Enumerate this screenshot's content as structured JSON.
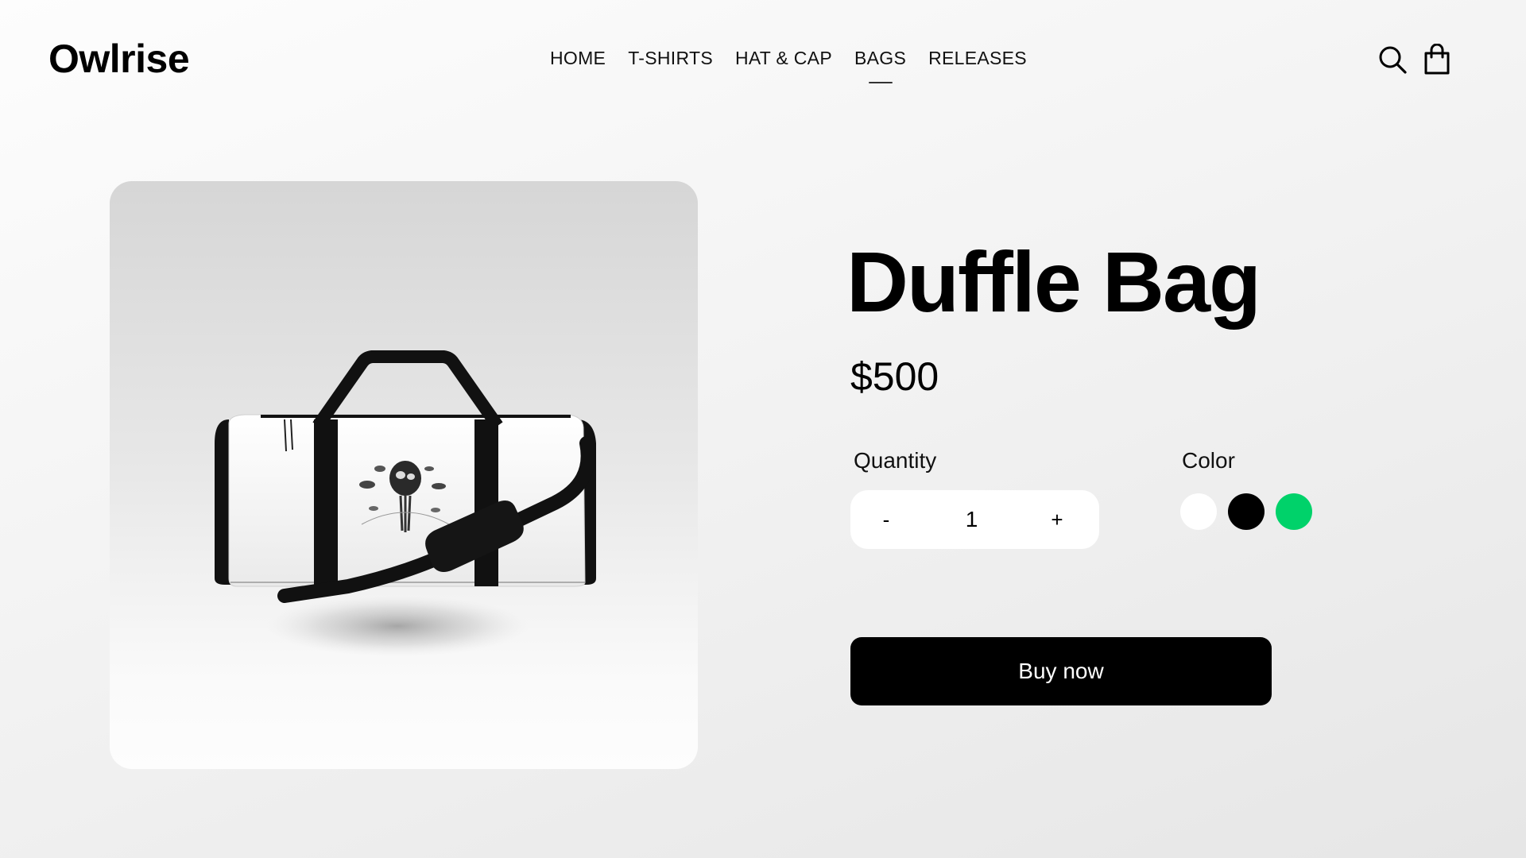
{
  "header": {
    "logo": "Owlrise",
    "nav": [
      {
        "label": "HOME"
      },
      {
        "label": "T-SHIRTS"
      },
      {
        "label": "HAT & CAP"
      },
      {
        "label": "BAGS",
        "active": true
      },
      {
        "label": "RELEASES"
      }
    ],
    "icons": [
      "search-icon",
      "shopping-bag-icon"
    ]
  },
  "product": {
    "title": "Duffle Bag",
    "price": "$500",
    "quantity_label": "Quantity",
    "quantity": {
      "decrement": "-",
      "value": "1",
      "increment": "+"
    },
    "color_label": "Color",
    "colors": [
      {
        "name": "white",
        "hex": "#ffffff"
      },
      {
        "name": "black",
        "hex": "#000000"
      },
      {
        "name": "green",
        "hex": "#00d26a"
      }
    ],
    "buy_label": "Buy now",
    "image": "white-duffle-bag-with-black-straps"
  }
}
